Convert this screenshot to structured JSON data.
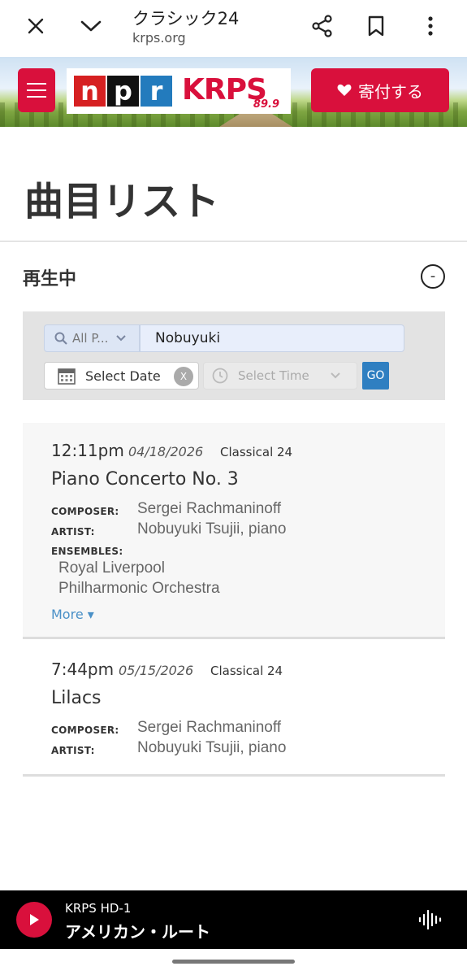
{
  "browser": {
    "title": "クラシック24",
    "url": "krps.org"
  },
  "header": {
    "logo_npr": [
      "n",
      "p",
      "r"
    ],
    "logo_station": "KRPS",
    "logo_freq": "89.9",
    "donate_label": "寄付する"
  },
  "page": {
    "title": "曲目リスト",
    "section_title": "再生中",
    "collapse_symbol": "-"
  },
  "filters": {
    "program_select": "All P...",
    "search_value": "Nobuyuki",
    "date_label": "Select Date",
    "date_clear": "X",
    "time_placeholder": "Select Time",
    "go_label": "GO"
  },
  "tracks": [
    {
      "time": "12:11pm",
      "date": "04/18/2026",
      "program": "Classical 24",
      "title": "Piano Concerto No. 3",
      "composer_label": "COMPOSER:",
      "composer": "Sergei Rachmaninoff",
      "artist_label": "ARTIST:",
      "artist": "Nobuyuki Tsujii, piano",
      "ensembles_label": "ENSEMBLES:",
      "ensembles": [
        "Royal Liverpool",
        "Philharmonic Orchestra"
      ],
      "more_label": "More ▾"
    },
    {
      "time": "7:44pm",
      "date": "05/15/2026",
      "program": "Classical 24",
      "title": "Lilacs",
      "composer_label": "COMPOSER:",
      "composer": "Sergei Rachmaninoff",
      "artist_label": "ARTIST:",
      "artist": "Nobuyuki Tsujii, piano"
    }
  ],
  "player": {
    "station": "KRPS HD-1",
    "now_playing": "アメリカン・ルート"
  },
  "colors": {
    "brand_red": "#d9103c",
    "go_blue": "#2f7fc1",
    "link_blue": "#4a90c7",
    "npr_red": "#d62021",
    "npr_black": "#111111",
    "npr_blue": "#237bbd"
  }
}
